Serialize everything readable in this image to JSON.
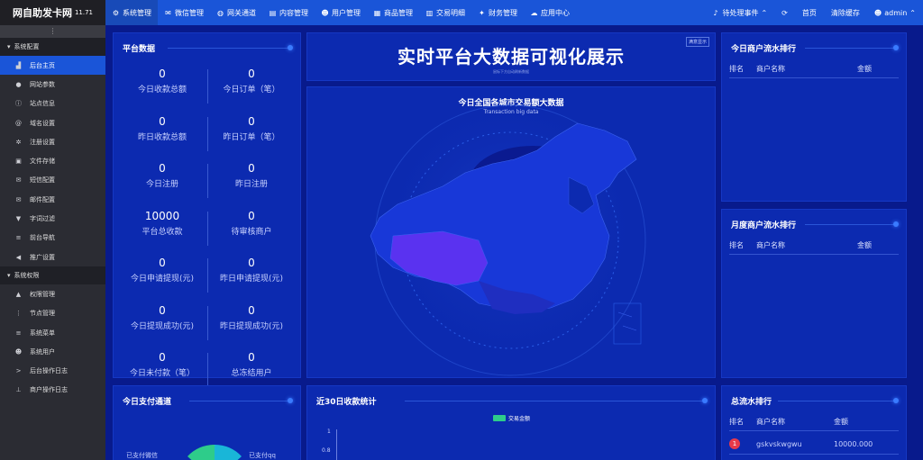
{
  "brand": {
    "name": "网自助发卡网",
    "version": "11.71"
  },
  "topnav": [
    {
      "label": "系统管理",
      "icon": "gear-icon",
      "glyph": "⚙",
      "active": true
    },
    {
      "label": "微信管理",
      "icon": "wechat-icon",
      "glyph": "✉",
      "active": false
    },
    {
      "label": "网关通道",
      "icon": "gateway-icon",
      "glyph": "◍",
      "active": false
    },
    {
      "label": "内容管理",
      "icon": "document-icon",
      "glyph": "▤",
      "active": false
    },
    {
      "label": "用户管理",
      "icon": "users-icon",
      "glyph": "☻",
      "active": false
    },
    {
      "label": "商品管理",
      "icon": "shop-icon",
      "glyph": "▦",
      "active": false
    },
    {
      "label": "交易明细",
      "icon": "chart-icon",
      "glyph": "▥",
      "active": false
    },
    {
      "label": "财务管理",
      "icon": "finance-icon",
      "glyph": "✦",
      "active": false
    },
    {
      "label": "应用中心",
      "icon": "cloud-icon",
      "glyph": "☁",
      "active": false
    }
  ],
  "topright": {
    "pending": "待处理事件",
    "home": "首页",
    "clear_cache": "清除缓存",
    "user": "admin"
  },
  "sidebar": {
    "collapse_glyph": "⋮",
    "group1": "系统配置",
    "group1_items": [
      {
        "label": "后台主页",
        "icon": "area-chart-icon",
        "glyph": "▟",
        "active": true
      },
      {
        "label": "网站参数",
        "icon": "apple-icon",
        "glyph": "●",
        "active": false
      },
      {
        "label": "站点信息",
        "icon": "info-icon",
        "glyph": "ⓘ",
        "active": false
      },
      {
        "label": "域名设置",
        "icon": "at-icon",
        "glyph": "@",
        "active": false
      },
      {
        "label": "注册设置",
        "icon": "cog-icon",
        "glyph": "✲",
        "active": false
      },
      {
        "label": "文件存储",
        "icon": "save-icon",
        "glyph": "▣",
        "active": false
      },
      {
        "label": "短信配置",
        "icon": "envelope-icon",
        "glyph": "✉",
        "active": false
      },
      {
        "label": "邮件配置",
        "icon": "mail-icon",
        "glyph": "✉",
        "active": false
      },
      {
        "label": "字词过滤",
        "icon": "filter-icon",
        "glyph": "▼",
        "active": false
      },
      {
        "label": "前台导航",
        "icon": "menu-icon",
        "glyph": "≡",
        "active": false
      },
      {
        "label": "推广设置",
        "icon": "bullhorn-icon",
        "glyph": "◀",
        "active": false
      }
    ],
    "group2": "系统权限",
    "group2_items": [
      {
        "label": "权限管理",
        "icon": "lock-icon",
        "glyph": "▲",
        "active": false
      },
      {
        "label": "节点管理",
        "icon": "dots-icon",
        "glyph": "⋮",
        "active": false
      },
      {
        "label": "系统菜单",
        "icon": "list-icon",
        "glyph": "≡",
        "active": false
      },
      {
        "label": "系统用户",
        "icon": "users-icon",
        "glyph": "☻",
        "active": false
      },
      {
        "label": "后台操作日志",
        "icon": "terminal-icon",
        "glyph": ">",
        "active": false
      },
      {
        "label": "商户操作日志",
        "icon": "pin-icon",
        "glyph": "⊥",
        "active": false
      }
    ]
  },
  "platform": {
    "title": "平台数据",
    "stats": [
      {
        "value": "0",
        "label": "今日收款总额"
      },
      {
        "value": "0",
        "label": "今日订单（笔）"
      },
      {
        "value": "0",
        "label": "昨日收款总额"
      },
      {
        "value": "0",
        "label": "昨日订单（笔）"
      },
      {
        "value": "0",
        "label": "今日注册"
      },
      {
        "value": "0",
        "label": "昨日注册"
      },
      {
        "value": "10000",
        "label": "平台总收款"
      },
      {
        "value": "0",
        "label": "待审核商户"
      },
      {
        "value": "0",
        "label": "今日申请提现(元)"
      },
      {
        "value": "0",
        "label": "昨日申请提现(元)"
      },
      {
        "value": "0",
        "label": "今日提现成功(元)"
      },
      {
        "value": "0",
        "label": "昨日提现成功(元)"
      },
      {
        "value": "0",
        "label": "今日未付款（笔）"
      },
      {
        "value": "0",
        "label": "总冻结用户"
      }
    ]
  },
  "hero": {
    "title": "实时平台大数据可视化展示",
    "subtitle": "鼠标下方自动刷新数据",
    "badge": "满意显示"
  },
  "map": {
    "title": "今日全国各城市交易额大数据",
    "subtitle": "Transaction big data"
  },
  "today_rank": {
    "title": "今日商户流水排行",
    "cols": [
      "排名",
      "商户名称",
      "金额"
    ]
  },
  "month_rank": {
    "title": "月度商户流水排行",
    "cols": [
      "排名",
      "商户名称",
      "金额"
    ]
  },
  "total_rank": {
    "title": "总流水排行",
    "cols": [
      "排名",
      "商户名称",
      "金额"
    ],
    "rows": [
      {
        "rank": "1",
        "name": "gskvskwgwu",
        "amount": "10000.000"
      }
    ]
  },
  "pay_channel": {
    "title": "今日支付通道",
    "label_left": "已支付微信",
    "label_right": "已支付qq"
  },
  "chart_data": {
    "type": "line",
    "title": "近30日收款统计",
    "series": [
      {
        "name": "交易金额",
        "values": []
      }
    ],
    "yticks": [
      "1",
      "0.8"
    ],
    "ylim": [
      0,
      1
    ],
    "legend": "top",
    "color": "#2ecc8a"
  }
}
